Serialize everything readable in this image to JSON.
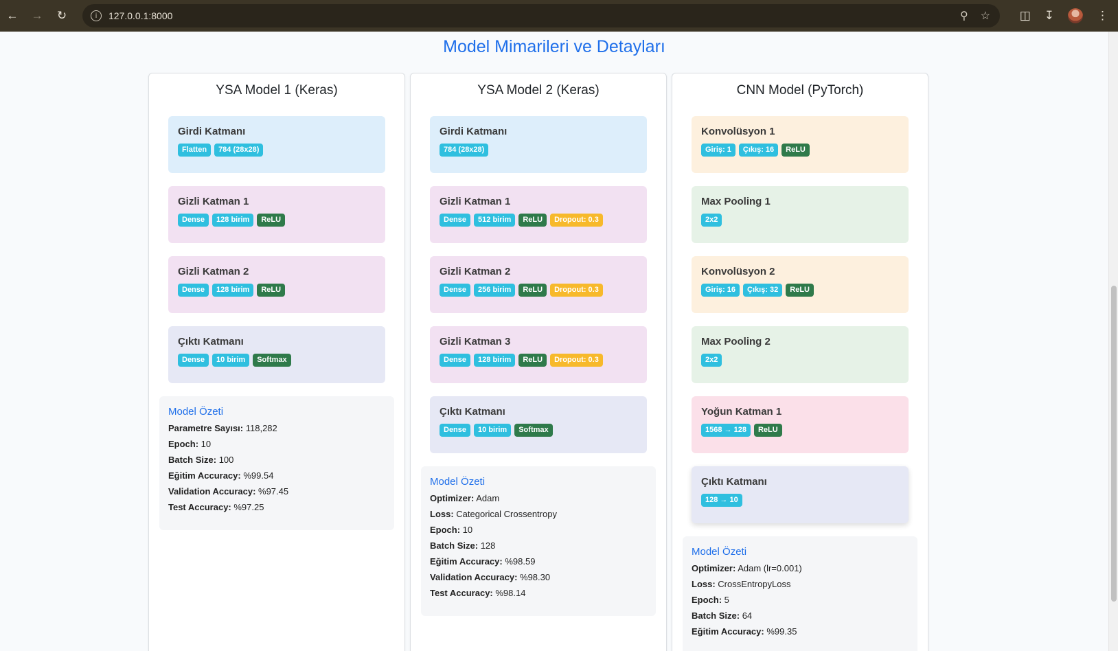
{
  "browser": {
    "url": "127.0.0.1:8000"
  },
  "page_title": "Model Mimarileri ve Detayları",
  "models": [
    {
      "title": "YSA Model 1 (Keras)",
      "layers": [
        {
          "name": "Girdi Katmanı",
          "color": "blue",
          "badges": [
            {
              "text": "Flatten",
              "kind": "info"
            },
            {
              "text": "784 (28x28)",
              "kind": "info"
            }
          ]
        },
        {
          "name": "Gizli Katman 1",
          "color": "purple",
          "badges": [
            {
              "text": "Dense",
              "kind": "info"
            },
            {
              "text": "128 birim",
              "kind": "info"
            },
            {
              "text": "ReLU",
              "kind": "green"
            }
          ]
        },
        {
          "name": "Gizli Katman 2",
          "color": "purple",
          "badges": [
            {
              "text": "Dense",
              "kind": "info"
            },
            {
              "text": "128 birim",
              "kind": "info"
            },
            {
              "text": "ReLU",
              "kind": "green"
            }
          ]
        },
        {
          "name": "Çıktı Katmanı",
          "color": "indigo",
          "badges": [
            {
              "text": "Dense",
              "kind": "info"
            },
            {
              "text": "10 birim",
              "kind": "info"
            },
            {
              "text": "Softmax",
              "kind": "green"
            }
          ]
        }
      ],
      "summary": {
        "title": "Model Özeti",
        "rows": [
          {
            "label": "Parametre Sayısı:",
            "value": "118,282"
          },
          {
            "label": "Epoch:",
            "value": "10"
          },
          {
            "label": "Batch Size:",
            "value": "100"
          },
          {
            "label": "Eğitim Accuracy:",
            "value": "%99.54"
          },
          {
            "label": "Validation Accuracy:",
            "value": "%97.45"
          },
          {
            "label": "Test Accuracy:",
            "value": "%97.25"
          }
        ]
      }
    },
    {
      "title": "YSA Model 2 (Keras)",
      "layers": [
        {
          "name": "Girdi Katmanı",
          "color": "blue",
          "badges": [
            {
              "text": "784 (28x28)",
              "kind": "info"
            }
          ]
        },
        {
          "name": "Gizli Katman 1",
          "color": "purple",
          "badges": [
            {
              "text": "Dense",
              "kind": "info"
            },
            {
              "text": "512 birim",
              "kind": "info"
            },
            {
              "text": "ReLU",
              "kind": "green"
            },
            {
              "text": "Dropout: 0.3",
              "kind": "warn"
            }
          ]
        },
        {
          "name": "Gizli Katman 2",
          "color": "purple",
          "badges": [
            {
              "text": "Dense",
              "kind": "info"
            },
            {
              "text": "256 birim",
              "kind": "info"
            },
            {
              "text": "ReLU",
              "kind": "green"
            },
            {
              "text": "Dropout: 0.3",
              "kind": "warn"
            }
          ]
        },
        {
          "name": "Gizli Katman 3",
          "color": "purple",
          "badges": [
            {
              "text": "Dense",
              "kind": "info"
            },
            {
              "text": "128 birim",
              "kind": "info"
            },
            {
              "text": "ReLU",
              "kind": "green"
            },
            {
              "text": "Dropout: 0.3",
              "kind": "warn"
            }
          ]
        },
        {
          "name": "Çıktı Katmanı",
          "color": "indigo",
          "badges": [
            {
              "text": "Dense",
              "kind": "info"
            },
            {
              "text": "10 birim",
              "kind": "info"
            },
            {
              "text": "Softmax",
              "kind": "green"
            }
          ]
        }
      ],
      "summary": {
        "title": "Model Özeti",
        "rows": [
          {
            "label": "Optimizer:",
            "value": "Adam"
          },
          {
            "label": "Loss:",
            "value": "Categorical Crossentropy"
          },
          {
            "label": "Epoch:",
            "value": "10"
          },
          {
            "label": "Batch Size:",
            "value": "128"
          },
          {
            "label": "Eğitim Accuracy:",
            "value": "%98.59"
          },
          {
            "label": "Validation Accuracy:",
            "value": "%98.30"
          },
          {
            "label": "Test Accuracy:",
            "value": "%98.14"
          }
        ]
      }
    },
    {
      "title": "CNN Model (PyTorch)",
      "layers": [
        {
          "name": "Konvolüsyon 1",
          "color": "orange",
          "badges": [
            {
              "text": "Giriş: 1",
              "kind": "info"
            },
            {
              "text": "Çıkış: 16",
              "kind": "info"
            },
            {
              "text": "ReLU",
              "kind": "green"
            }
          ]
        },
        {
          "name": "Max Pooling 1",
          "color": "green",
          "badges": [
            {
              "text": "2x2",
              "kind": "info"
            }
          ]
        },
        {
          "name": "Konvolüsyon 2",
          "color": "orange",
          "badges": [
            {
              "text": "Giriş: 16",
              "kind": "info"
            },
            {
              "text": "Çıkış: 32",
              "kind": "info"
            },
            {
              "text": "ReLU",
              "kind": "green"
            }
          ]
        },
        {
          "name": "Max Pooling 2",
          "color": "green",
          "badges": [
            {
              "text": "2x2",
              "kind": "info"
            }
          ]
        },
        {
          "name": "Yoğun Katman 1",
          "color": "pink",
          "badges": [
            {
              "text": "1568 → 128",
              "kind": "info"
            },
            {
              "text": "ReLU",
              "kind": "green"
            }
          ]
        },
        {
          "name": "Çıktı Katmanı",
          "color": "indigo",
          "shadow": true,
          "badges": [
            {
              "text": "128 → 10",
              "kind": "info"
            }
          ]
        }
      ],
      "summary": {
        "title": "Model Özeti",
        "rows": [
          {
            "label": "Optimizer:",
            "value": "Adam (lr=0.001)"
          },
          {
            "label": "Loss:",
            "value": "CrossEntropyLoss"
          },
          {
            "label": "Epoch:",
            "value": "5"
          },
          {
            "label": "Batch Size:",
            "value": "64"
          },
          {
            "label": "Eğitim Accuracy:",
            "value": "%99.35"
          }
        ]
      }
    }
  ]
}
